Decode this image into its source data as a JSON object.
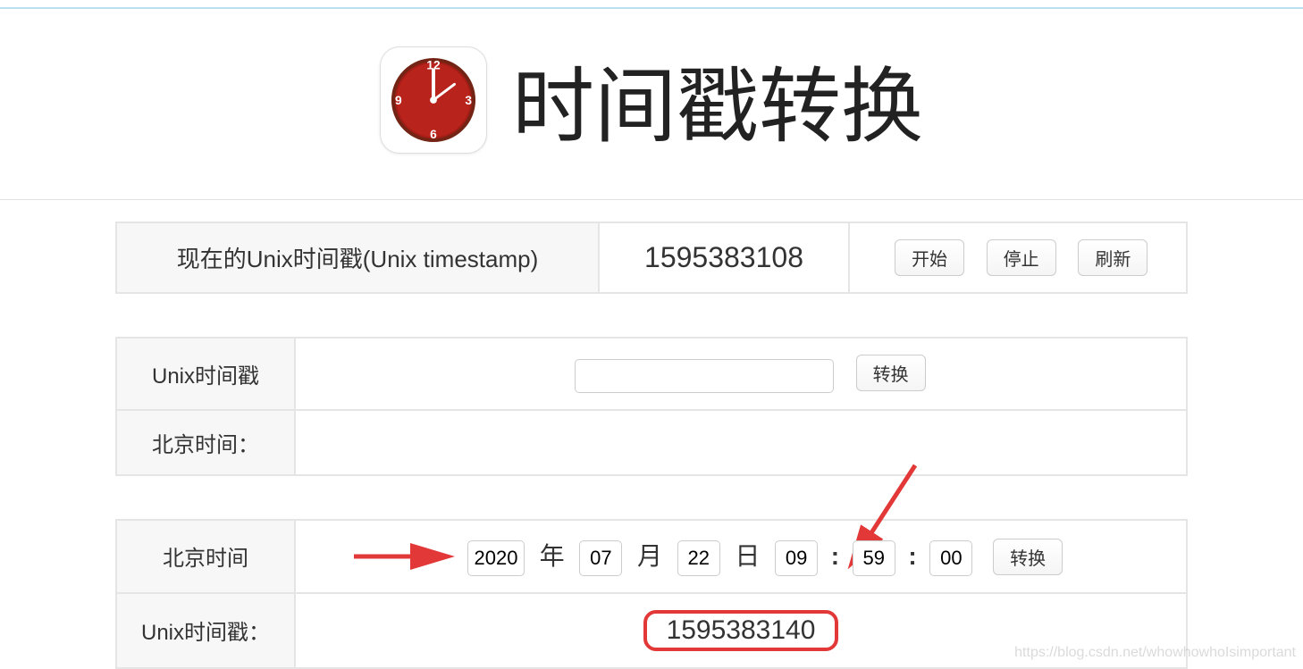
{
  "header": {
    "title": "时间戳转换"
  },
  "current": {
    "label": "现在的Unix时间戳(Unix timestamp)",
    "value": "1595383108",
    "buttons": {
      "start": "开始",
      "stop": "停止",
      "refresh": "刷新"
    }
  },
  "ts_to_date": {
    "label": "Unix时间戳",
    "convert": "转换",
    "result_label": "北京时间："
  },
  "date_to_ts": {
    "label": "北京时间",
    "year": "2020",
    "year_unit": "年",
    "month": "07",
    "month_unit": "月",
    "day": "22",
    "day_unit": "日",
    "hour": "09",
    "minute": "59",
    "second": "00",
    "convert": "转换",
    "result_label": "Unix时间戳：",
    "result_value": "1595383140"
  },
  "watermark": "https://blog.csdn.net/whowhowhoIsimportant"
}
